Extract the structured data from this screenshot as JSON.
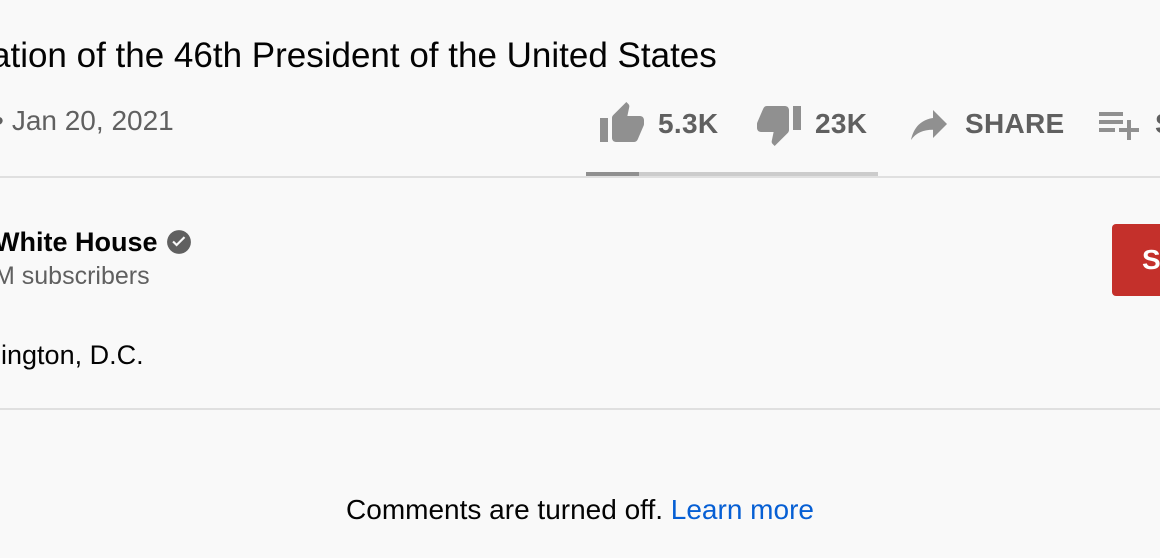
{
  "video": {
    "title": "ation of the 46th President of the United States",
    "date_prefix": "•",
    "date": "Jan 20, 2021"
  },
  "actions": {
    "like_count": "5.3K",
    "dislike_count": "23K",
    "share_label": "SHARE",
    "save_label": "S"
  },
  "icons": {
    "like": "thumbs-up-icon",
    "dislike": "thumbs-down-icon",
    "share": "share-arrow-icon",
    "save": "playlist-add-icon",
    "verified": "verified-check-icon"
  },
  "sentiment": {
    "like_fraction": 0.18
  },
  "channel": {
    "name": "White House",
    "subscribers": "M subscribers",
    "subscribe_label": "S"
  },
  "description": {
    "text": "hington, D.C."
  },
  "comments": {
    "off_message": "Comments are turned off.",
    "learn_more": "Learn more"
  },
  "colors": {
    "subscribe_red": "#c4302b",
    "link_blue": "#065fd4",
    "icon_gray": "#909090",
    "secondary_text": "#606060"
  }
}
